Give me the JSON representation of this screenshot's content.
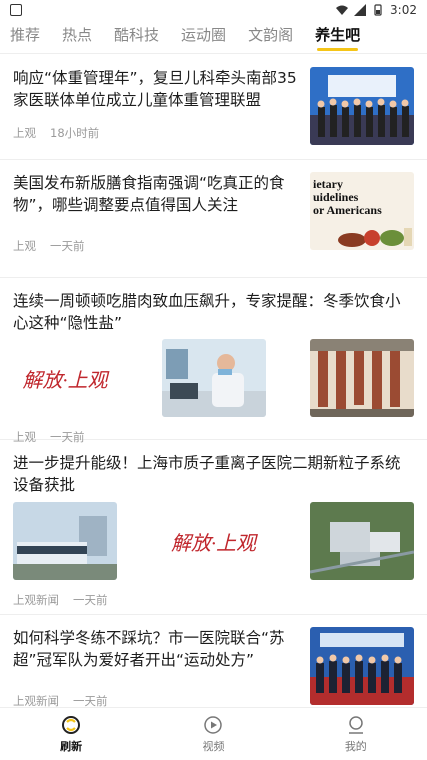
{
  "status": {
    "time": "3:02"
  },
  "tabs": [
    {
      "label": "推荐"
    },
    {
      "label": "热点"
    },
    {
      "label": "酷科技"
    },
    {
      "label": "运动圈"
    },
    {
      "label": "文韵阁"
    },
    {
      "label": "养生吧"
    }
  ],
  "feed": [
    {
      "title": "响应“体重管理年”，复旦儿科牵头南部35家医联体单位成立儿童体重管理联盟",
      "source": "上观",
      "time": "18小时前"
    },
    {
      "title": "美国发布新版膳食指南强调“吃真正的食物”，哪些调整要点值得国人关注",
      "source": "上观",
      "time": "一天前",
      "thumb_text": [
        "ietary",
        "uidelines",
        "or Americans"
      ]
    },
    {
      "title": "连续一周顿顿吃腊肉致血压飙升，专家提醒：冬季饮食小心这种“隐性盐”",
      "source": "上观",
      "time": "一天前",
      "logo_text": "解放·上观"
    },
    {
      "title": "进一步提升能级！上海市质子重离子医院二期新粒子系统设备获批",
      "source": "上观新闻",
      "time": "一天前",
      "logo_text": "解放·上观"
    },
    {
      "title": "如何科学冬练不踩坑？市一医院联合“苏超”冠军队为爱好者开出“运动处方”",
      "source": "上观新闻",
      "time": "一天前"
    }
  ],
  "nav": [
    {
      "label": "刷新",
      "icon": "refresh-icon"
    },
    {
      "label": "视频",
      "icon": "play-icon"
    },
    {
      "label": "我的",
      "icon": "user-icon"
    }
  ]
}
